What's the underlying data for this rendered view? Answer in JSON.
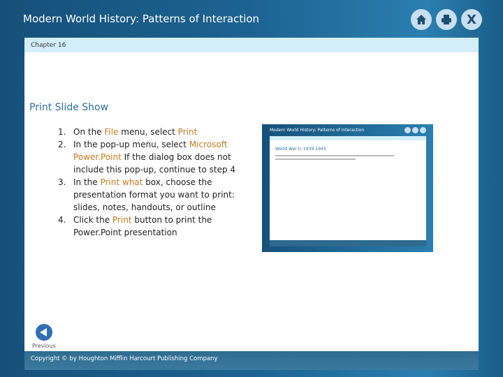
{
  "header": {
    "title": "Modern World History: Patterns of Interaction",
    "icons": [
      "home-icon",
      "print-icon",
      "close-icon"
    ],
    "close_label": "X"
  },
  "chapter": "Chapter 16",
  "heading": "Print Slide Show",
  "steps": [
    {
      "n": "1.",
      "parts": [
        [
          "On the ",
          0
        ],
        [
          "File",
          1
        ],
        [
          " menu, select ",
          0
        ],
        [
          "Print",
          1
        ]
      ]
    },
    {
      "n": "2.",
      "parts": [
        [
          "In the pop-up menu, select ",
          0
        ],
        [
          "Microsoft Power.Point",
          1
        ],
        [
          " If the dialog box does not include this pop-up, continue to step 4",
          0
        ]
      ]
    },
    {
      "n": "3.",
      "parts": [
        [
          "In the ",
          0
        ],
        [
          "Print what",
          1
        ],
        [
          " box, choose the presentation format you want to print: slides, notes, handouts, or outline",
          0
        ]
      ]
    },
    {
      "n": "4.",
      "parts": [
        [
          "Click the ",
          0
        ],
        [
          "Print",
          1
        ],
        [
          " button to print the Power.Point presentation",
          0
        ]
      ]
    }
  ],
  "thumbnail": {
    "title": "Modern World History: Patterns of Interaction",
    "heading": "World War II, 1939-1945"
  },
  "nav": {
    "previous": "Previous"
  },
  "footer": "Copyright © by Houghton Mifflin Harcourt Publishing Company",
  "colors": {
    "accent": "#c47a1f",
    "heading": "#2a6fa0",
    "chapter_bar": "#d4eef9"
  }
}
